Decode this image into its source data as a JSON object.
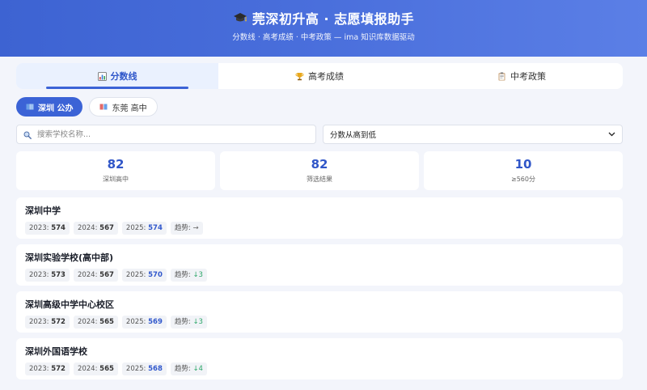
{
  "header": {
    "title": "莞深初升高 · 志愿填报助手",
    "subtitle": "分数线 · 高考成绩 · 中考政策 — ima 知识库数据驱动",
    "icon": "graduation-cap-icon"
  },
  "tabs": [
    {
      "label": "分数线",
      "icon": "bar-chart-icon",
      "active": true
    },
    {
      "label": "高考成绩",
      "icon": "trophy-icon",
      "active": false
    },
    {
      "label": "中考政策",
      "icon": "clipboard-icon",
      "active": false
    }
  ],
  "cities": [
    {
      "label": "深圳 公办",
      "icon": "book-icon",
      "active": true
    },
    {
      "label": "东莞 高中",
      "icon": "book-icon",
      "active": false
    }
  ],
  "search": {
    "placeholder": "搜索学校名称...",
    "value": ""
  },
  "sort": {
    "selected": "分数从高到低"
  },
  "stats": [
    {
      "value": "82",
      "label": "深圳高中"
    },
    {
      "value": "82",
      "label": "筛选结果"
    },
    {
      "value": "10",
      "label": "≥560分"
    }
  ],
  "schools": [
    {
      "name": "深圳中学",
      "y2023_label": "2023:",
      "y2023": "574",
      "y2024_label": "2024:",
      "y2024": "567",
      "y2025_label": "2025:",
      "y2025": "574",
      "trend_label": "趋势:",
      "trend": "→",
      "trend_type": "flat"
    },
    {
      "name": "深圳实验学校(高中部)",
      "y2023_label": "2023:",
      "y2023": "573",
      "y2024_label": "2024:",
      "y2024": "567",
      "y2025_label": "2025:",
      "y2025": "570",
      "trend_label": "趋势:",
      "trend": "↓3",
      "trend_type": "down"
    },
    {
      "name": "深圳高级中学中心校区",
      "y2023_label": "2023:",
      "y2023": "572",
      "y2024_label": "2024:",
      "y2024": "565",
      "y2025_label": "2025:",
      "y2025": "569",
      "trend_label": "趋势:",
      "trend": "↓3",
      "trend_type": "down"
    },
    {
      "name": "深圳外国语学校",
      "y2023_label": "2023:",
      "y2023": "572",
      "y2024_label": "2024:",
      "y2024": "565",
      "y2025_label": "2025:",
      "y2025": "568",
      "trend_label": "趋势:",
      "trend": "↓4",
      "trend_type": "down"
    }
  ],
  "colors": {
    "accent": "#3b63d6",
    "header_start": "#3d63d2",
    "header_end": "#5b7fe6",
    "trend_down": "#2aa567",
    "background": "#f3f5fb"
  }
}
